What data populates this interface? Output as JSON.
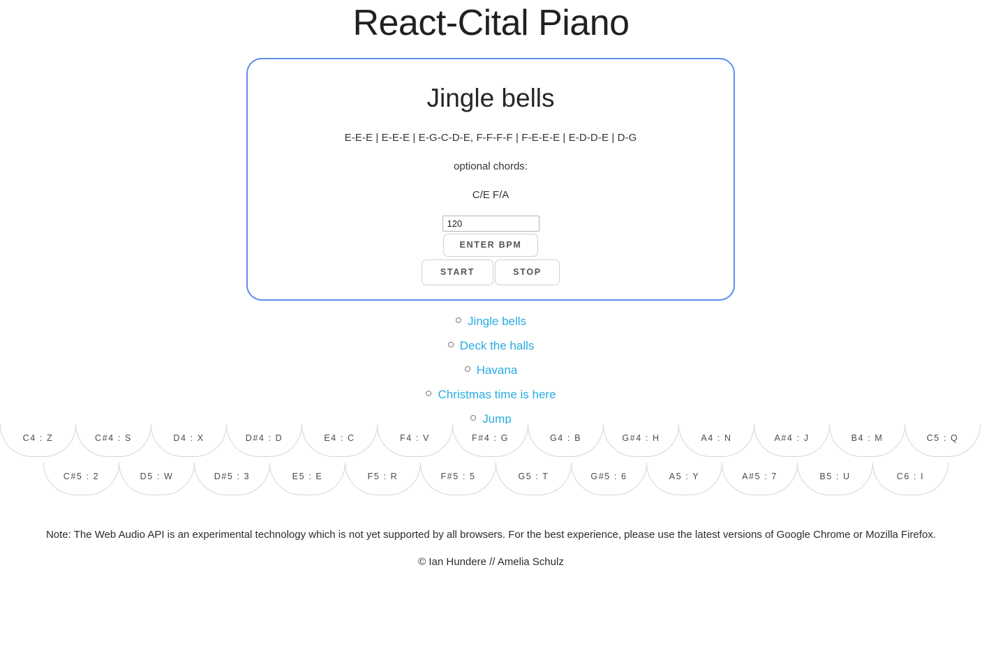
{
  "header": {
    "title": "React-Cital Piano"
  },
  "card": {
    "song_title": "Jingle bells",
    "notes": "E-E-E | E-E-E | E-G-C-D-E, F-F-F-F | F-E-E-E | E-D-D-E | D-G",
    "chords_label": "optional chords:",
    "chords_value": "C/E F/A",
    "border_color": "#5b8def",
    "bpm": {
      "value": "120",
      "placeholder": "BPM",
      "enter_label": "Enter BPM"
    },
    "transport": {
      "start_label": "Start",
      "stop_label": "Stop"
    }
  },
  "song_list": {
    "items": [
      {
        "label": "Jingle bells"
      },
      {
        "label": "Deck the halls"
      },
      {
        "label": "Havana"
      },
      {
        "label": "Christmas time is here"
      },
      {
        "label": "Jump"
      }
    ],
    "link_color": "#29abe2",
    "bullet_icon": "circle-marker"
  },
  "piano": {
    "row1": [
      {
        "label": "C4 : Z"
      },
      {
        "label": "C#4 : S"
      },
      {
        "label": "D4 : X"
      },
      {
        "label": "D#4 : D"
      },
      {
        "label": "E4 : C"
      },
      {
        "label": "F4 : V"
      },
      {
        "label": "F#4 : G"
      },
      {
        "label": "G4 : B"
      },
      {
        "label": "G#4 : H"
      },
      {
        "label": "A4 : N"
      },
      {
        "label": "A#4 : J"
      },
      {
        "label": "B4 : M"
      },
      {
        "label": "C5 : Q"
      }
    ],
    "row2": [
      {
        "label": "C#5 : 2"
      },
      {
        "label": "D5 : W"
      },
      {
        "label": "D#5 : 3"
      },
      {
        "label": "E5 : E"
      },
      {
        "label": "F5 : R"
      },
      {
        "label": "F#5 : 5"
      },
      {
        "label": "G5 : T"
      },
      {
        "label": "G#5 : 6"
      },
      {
        "label": "A5 : Y"
      },
      {
        "label": "A#5 : 7"
      },
      {
        "label": "B5 : U"
      },
      {
        "label": "C6 : I"
      }
    ]
  },
  "footer": {
    "note": "Note: The Web Audio API is an experimental technology which is not yet supported by all browsers. For the best experience, please use the latest versions of Google Chrome or Mozilla Firefox.",
    "copyright": "© Ian Hundere // Amelia Schulz"
  }
}
